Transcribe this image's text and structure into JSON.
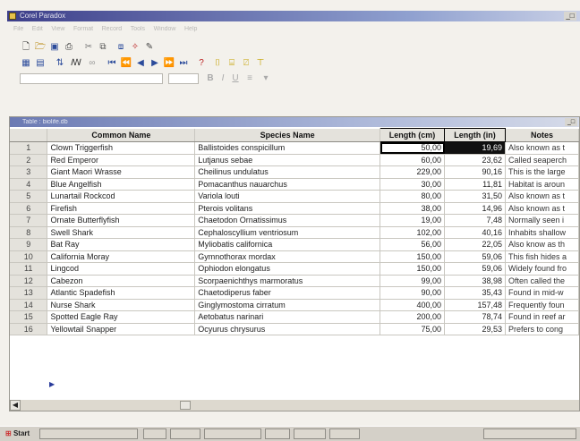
{
  "app": {
    "title": "Corel Paradox",
    "menu": [
      "File",
      "Edit",
      "View",
      "Format",
      "Record",
      "Tools",
      "Window",
      "Help"
    ]
  },
  "child_window": {
    "title": "Table : biolife.db"
  },
  "table": {
    "columns": [
      "",
      "Common Name",
      "Species Name",
      "Length (cm)",
      "Length (in)",
      "Notes"
    ],
    "rows": [
      [
        "1",
        "Clown Triggerfish",
        "Ballistoides conspicillum",
        "50,00",
        "19,69",
        "Also known as t"
      ],
      [
        "2",
        "Red Emperor",
        "Lutjanus sebae",
        "60,00",
        "23,62",
        "Called seaperch"
      ],
      [
        "3",
        "Giant Maori Wrasse",
        "Cheilinus undulatus",
        "229,00",
        "90,16",
        "This is the large"
      ],
      [
        "4",
        "Blue Angelfish",
        "Pomacanthus nauarchus",
        "30,00",
        "11,81",
        "Habitat is aroun"
      ],
      [
        "5",
        "Lunartail Rockcod",
        "Variola louti",
        "80,00",
        "31,50",
        "Also known as t"
      ],
      [
        "6",
        "Firefish",
        "Pterois volitans",
        "38,00",
        "14,96",
        "Also known as t"
      ],
      [
        "7",
        "Ornate Butterflyfish",
        "Chaetodon Ornatissimus",
        "19,00",
        "7,48",
        "Normally seen i"
      ],
      [
        "8",
        "Swell Shark",
        "Cephaloscyllium ventriosum",
        "102,00",
        "40,16",
        "Inhabits shallow"
      ],
      [
        "9",
        "Bat Ray",
        "Myliobatis californica",
        "56,00",
        "22,05",
        "Also know as th"
      ],
      [
        "10",
        "California Moray",
        "Gymnothorax mordax",
        "150,00",
        "59,06",
        "This fish hides a"
      ],
      [
        "11",
        "Lingcod",
        "Ophiodon elongatus",
        "150,00",
        "59,06",
        "Widely found fro"
      ],
      [
        "12",
        "Cabezon",
        "Scorpaenichthys marmoratus",
        "99,00",
        "38,98",
        "Often called the"
      ],
      [
        "13",
        "Atlantic Spadefish",
        "Chaetodiperus faber",
        "90,00",
        "35,43",
        "Found in mid-w"
      ],
      [
        "14",
        "Nurse Shark",
        "Ginglymostoma cirratum",
        "400,00",
        "157,48",
        "Frequently foun"
      ],
      [
        "15",
        "Spotted Eagle Ray",
        "Aetobatus narinari",
        "200,00",
        "78,74",
        "Found in reef ar"
      ],
      [
        "16",
        "Yellowtail Snapper",
        "Ocyurus chrysurus",
        "75,00",
        "29,53",
        "Prefers to cong"
      ]
    ]
  },
  "taskbar": {
    "start_label": "Start"
  },
  "icons": {
    "toolbar1": [
      "new-icon",
      "open-icon",
      "save-icon",
      "print-icon",
      "cut-icon",
      "copy-icon",
      "paste-icon",
      "magic-icon"
    ],
    "toolbar2": [
      "table-view-icon",
      "form-view-icon",
      "sort-icon",
      "find-icon",
      "binoculars-icon",
      "first-record-icon",
      "prev-set-icon",
      "prev-record-icon",
      "next-record-icon",
      "next-set-icon",
      "last-record-icon",
      "filter-icon",
      "edit-data-icon",
      "insert-record-icon",
      "delete-record-icon",
      "post-record-icon"
    ]
  }
}
